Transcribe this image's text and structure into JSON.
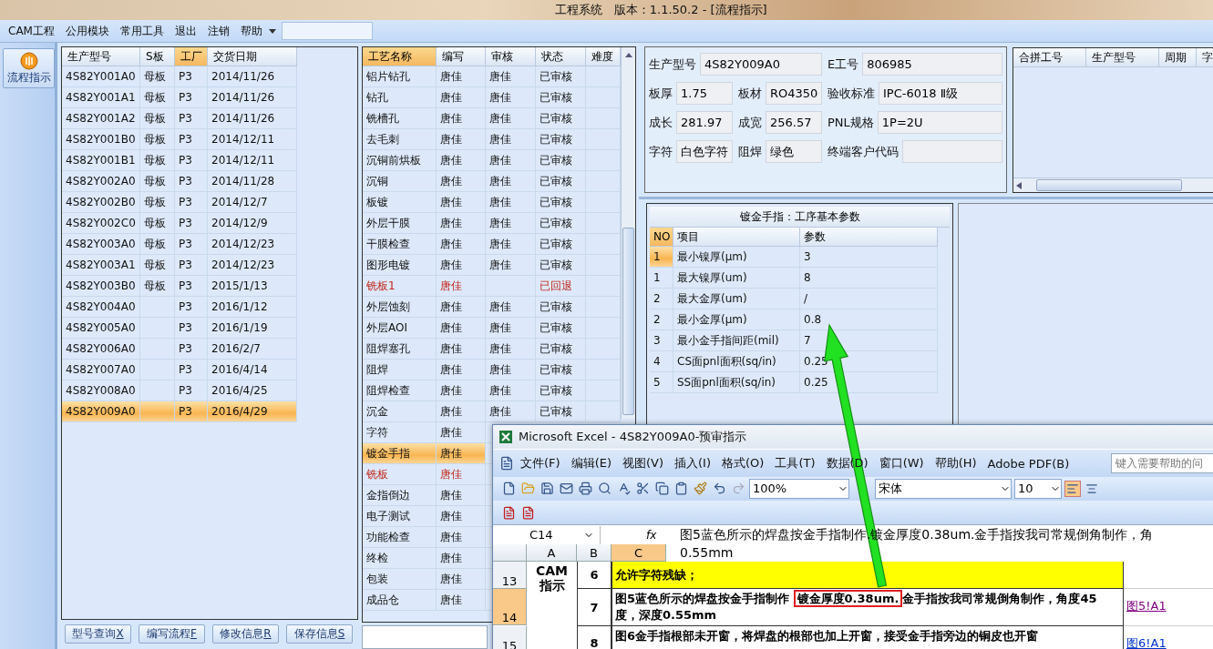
{
  "window": {
    "title": "工程系统   版本：1.1.50.2 - [流程指示]"
  },
  "menu": {
    "items": [
      "CAM工程",
      "公用模块",
      "常用工具",
      "退出",
      "注销",
      "帮助"
    ]
  },
  "nav": {
    "items": [
      {
        "label": "流程指示",
        "selected": true
      }
    ]
  },
  "models_table": {
    "columns": [
      {
        "label": "生产型号",
        "highlighted": false
      },
      {
        "label": "S板",
        "highlighted": false
      },
      {
        "label": "工厂",
        "highlighted": true
      },
      {
        "label": "交货日期",
        "highlighted": false
      }
    ],
    "rows": [
      {
        "cells": [
          "4S82Y001A0",
          "母板",
          "P3",
          "2014/11/26"
        ],
        "selected": false
      },
      {
        "cells": [
          "4S82Y001A1",
          "母板",
          "P3",
          "2014/11/26"
        ],
        "selected": false
      },
      {
        "cells": [
          "4S82Y001A2",
          "母板",
          "P3",
          "2014/11/26"
        ],
        "selected": false
      },
      {
        "cells": [
          "4S82Y001B0",
          "母板",
          "P3",
          "2014/12/11"
        ],
        "selected": false
      },
      {
        "cells": [
          "4S82Y001B1",
          "母板",
          "P3",
          "2014/12/11"
        ],
        "selected": false
      },
      {
        "cells": [
          "4S82Y002A0",
          "母板",
          "P3",
          "2014/11/28"
        ],
        "selected": false
      },
      {
        "cells": [
          "4S82Y002B0",
          "母板",
          "P3",
          "2014/12/7"
        ],
        "selected": false
      },
      {
        "cells": [
          "4S82Y002C0",
          "母板",
          "P3",
          "2014/12/9"
        ],
        "selected": false
      },
      {
        "cells": [
          "4S82Y003A0",
          "母板",
          "P3",
          "2014/12/23"
        ],
        "selected": false
      },
      {
        "cells": [
          "4S82Y003A1",
          "母板",
          "P3",
          "2014/12/23"
        ],
        "selected": false
      },
      {
        "cells": [
          "4S82Y003B0",
          "母板",
          "P3",
          "2015/1/13"
        ],
        "selected": false
      },
      {
        "cells": [
          "4S82Y004A0",
          null,
          "P3",
          "2016/1/12"
        ],
        "selected": false
      },
      {
        "cells": [
          "4S82Y005A0",
          null,
          "P3",
          "2016/1/19"
        ],
        "selected": false
      },
      {
        "cells": [
          "4S82Y006A0",
          null,
          "P3",
          "2016/2/7"
        ],
        "selected": false
      },
      {
        "cells": [
          "4S82Y007A0",
          null,
          "P3",
          "2016/4/14"
        ],
        "selected": false
      },
      {
        "cells": [
          "4S82Y008A0",
          null,
          "P3",
          "2016/4/25"
        ],
        "selected": false
      },
      {
        "cells": [
          "4S82Y009A0",
          null,
          "P3",
          "2016/4/29"
        ],
        "selected": true
      }
    ]
  },
  "actions": [
    {
      "label": "型号查询",
      "shortcut": "X"
    },
    {
      "label": "编写流程",
      "shortcut": "F"
    },
    {
      "label": "修改信息",
      "shortcut": "R"
    },
    {
      "label": "保存信息",
      "shortcut": "S"
    }
  ],
  "process_table": {
    "columns": [
      {
        "label": "工艺名称",
        "highlighted": true
      },
      {
        "label": "编写",
        "highlighted": false
      },
      {
        "label": "审核",
        "highlighted": false
      },
      {
        "label": "状态",
        "highlighted": false
      },
      {
        "label": "难度",
        "highlighted": false
      }
    ],
    "rows": [
      {
        "name": "铝片钻孔",
        "writer": "唐佳",
        "reviewer": "唐佳",
        "status": "已审核",
        "returned": false,
        "selected": false
      },
      {
        "name": "钻孔",
        "writer": "唐佳",
        "reviewer": "唐佳",
        "status": "已审核",
        "returned": false,
        "selected": false
      },
      {
        "name": "铣槽孔",
        "writer": "唐佳",
        "reviewer": "唐佳",
        "status": "已审核",
        "returned": false,
        "selected": false
      },
      {
        "name": "去毛刺",
        "writer": "唐佳",
        "reviewer": "唐佳",
        "status": "已审核",
        "returned": false,
        "selected": false
      },
      {
        "name": "沉铜前烘板",
        "writer": "唐佳",
        "reviewer": "唐佳",
        "status": "已审核",
        "returned": false,
        "selected": false
      },
      {
        "name": "沉铜",
        "writer": "唐佳",
        "reviewer": "唐佳",
        "status": "已审核",
        "returned": false,
        "selected": false
      },
      {
        "name": "板镀",
        "writer": "唐佳",
        "reviewer": "唐佳",
        "status": "已审核",
        "returned": false,
        "selected": false
      },
      {
        "name": "外层干膜",
        "writer": "唐佳",
        "reviewer": "唐佳",
        "status": "已审核",
        "returned": false,
        "selected": false
      },
      {
        "name": "干膜检查",
        "writer": "唐佳",
        "reviewer": "唐佳",
        "status": "已审核",
        "returned": false,
        "selected": false
      },
      {
        "name": "图形电镀",
        "writer": "唐佳",
        "reviewer": "唐佳",
        "status": "已审核",
        "returned": false,
        "selected": false
      },
      {
        "name": "铣板1",
        "writer": "唐佳",
        "status": "已回退",
        "returned": true,
        "selected": false
      },
      {
        "name": "外层蚀刻",
        "writer": "唐佳",
        "reviewer": "唐佳",
        "status": "已审核",
        "returned": false,
        "selected": false
      },
      {
        "name": "外层AOI",
        "writer": "唐佳",
        "reviewer": "唐佳",
        "status": "已审核",
        "returned": false,
        "selected": false
      },
      {
        "name": "阻焊塞孔",
        "writer": "唐佳",
        "reviewer": "唐佳",
        "status": "已审核",
        "returned": false,
        "selected": false
      },
      {
        "name": "阻焊",
        "writer": "唐佳",
        "reviewer": "唐佳",
        "status": "已审核",
        "returned": false,
        "selected": false
      },
      {
        "name": "阻焊检查",
        "writer": "唐佳",
        "reviewer": "唐佳",
        "status": "已审核",
        "returned": false,
        "selected": false
      },
      {
        "name": "沉金",
        "writer": "唐佳",
        "reviewer": "唐佳",
        "status": "已审核",
        "returned": false,
        "selected": false
      },
      {
        "name": "字符",
        "writer": "唐佳",
        "returned": false,
        "selected": false
      },
      {
        "name": "镀金手指",
        "writer": "唐佳",
        "returned": false,
        "selected": true
      },
      {
        "name": "铣板",
        "writer": "唐佳",
        "returned": true,
        "selected": false
      },
      {
        "name": "金指倒边",
        "writer": "唐佳",
        "returned": false,
        "selected": false
      },
      {
        "name": "电子测试",
        "writer": "唐佳",
        "returned": false,
        "selected": false
      },
      {
        "name": "功能检查",
        "writer": "唐佳",
        "returned": false,
        "selected": false
      },
      {
        "name": "终检",
        "writer": "唐佳",
        "returned": false,
        "selected": false
      },
      {
        "name": "包装",
        "writer": "唐佳",
        "returned": false,
        "selected": false
      },
      {
        "name": "成品仓",
        "writer": "唐佳",
        "returned": false,
        "selected": false
      }
    ]
  },
  "job_info": {
    "fields": [
      {
        "label": "生产型号",
        "value": "4S82Y009A0"
      },
      {
        "label": "E工号",
        "value": "806985"
      },
      {
        "label": "板厚",
        "value": "1.75"
      },
      {
        "label": "板材",
        "value": "RO4350"
      },
      {
        "label": "验收标准",
        "value": "IPC-6018 Ⅱ级"
      },
      {
        "label": "成长",
        "value": "281.97"
      },
      {
        "label": "成宽",
        "value": "256.57"
      },
      {
        "label": "PNL规格",
        "value": "1P=2U"
      },
      {
        "label": "字符",
        "value": "白色字符"
      },
      {
        "label": "阻焊",
        "value": "绿色"
      },
      {
        "label": "终端客户代码"
      }
    ]
  },
  "merge_table": {
    "columns": [
      "合拼工号",
      "生产型号",
      "周期",
      "字"
    ]
  },
  "param_table": {
    "title": "镀金手指：工序基本参数",
    "columns": [
      {
        "label": "NO",
        "highlighted": true
      },
      {
        "label": "项目",
        "highlighted": false
      },
      {
        "label": "参数",
        "highlighted": false
      }
    ],
    "rows": [
      {
        "no": "1",
        "item": "最小镍厚(μm)",
        "value": "3",
        "selected": true
      },
      {
        "no": "1",
        "item": "最大镍厚(um)",
        "value": "8",
        "selected": false
      },
      {
        "no": "2",
        "item": "最大金厚(um)",
        "value": "/",
        "selected": false
      },
      {
        "no": "2",
        "item": "最小金厚(μm)",
        "value": "0.8",
        "selected": false
      },
      {
        "no": "3",
        "item": "最小金手指间距(mil)",
        "value": "7",
        "selected": false
      },
      {
        "no": "4",
        "item": "CS面pnl面积(sq/in)",
        "value": "0.25",
        "selected": false
      },
      {
        "no": "5",
        "item": "SS面pnl面积(sq/in)",
        "value": "0.25",
        "selected": false
      }
    ]
  },
  "excel": {
    "title": "Microsoft Excel - 4S82Y009A0-预审指示",
    "menu": [
      "文件(F)",
      "编辑(E)",
      "视图(V)",
      "插入(I)",
      "格式(O)",
      "工具(T)",
      "数据(D)",
      "窗口(W)",
      "帮助(H)",
      "Adobe PDF(B)"
    ],
    "help_placeholder": "键入需要帮助的问",
    "zoom": "100%",
    "font": "宋体",
    "size": "10",
    "name_box": "C14",
    "formula_label": "fx",
    "formula_lines": [
      "图5蓝色所示的焊盘按金手指制作.镀金厚度0.38um.金手指按我司常规倒角制作，角",
      "0.55mm"
    ],
    "columns": [
      {
        "label": "A",
        "selected": false
      },
      {
        "label": "B",
        "selected": false
      },
      {
        "label": "C",
        "selected": true
      }
    ],
    "section_label": "CAM 指示",
    "rows": [
      {
        "header": "13",
        "selected": false,
        "step": "6",
        "kind": "highlight",
        "segments": [
          {
            "text": "允许字符残缺；",
            "boxed": false
          }
        ]
      },
      {
        "header": "14",
        "selected": true,
        "step": "7",
        "kind": "plain",
        "segments": [
          {
            "text": "图5蓝色所示的焊盘按金手指制作 ",
            "boxed": false
          },
          {
            "text": "镀金厚度0.38um.",
            "boxed": true
          },
          {
            "text": "金手指按我司常规倒角制作，角度45度，深度0.55mm",
            "boxed": false
          }
        ],
        "link": {
          "text": "图5!A1",
          "visited": true
        }
      },
      {
        "header": "15",
        "selected": false,
        "step": "8",
        "kind": "plain",
        "segments": [
          {
            "text": "图6金手指根部未开窗，将焊盘的根部也加上开窗，接受金手指旁边的铜皮也开窗",
            "boxed": false
          }
        ],
        "link": {
          "text": "图6!A1",
          "visited": false
        }
      }
    ]
  }
}
